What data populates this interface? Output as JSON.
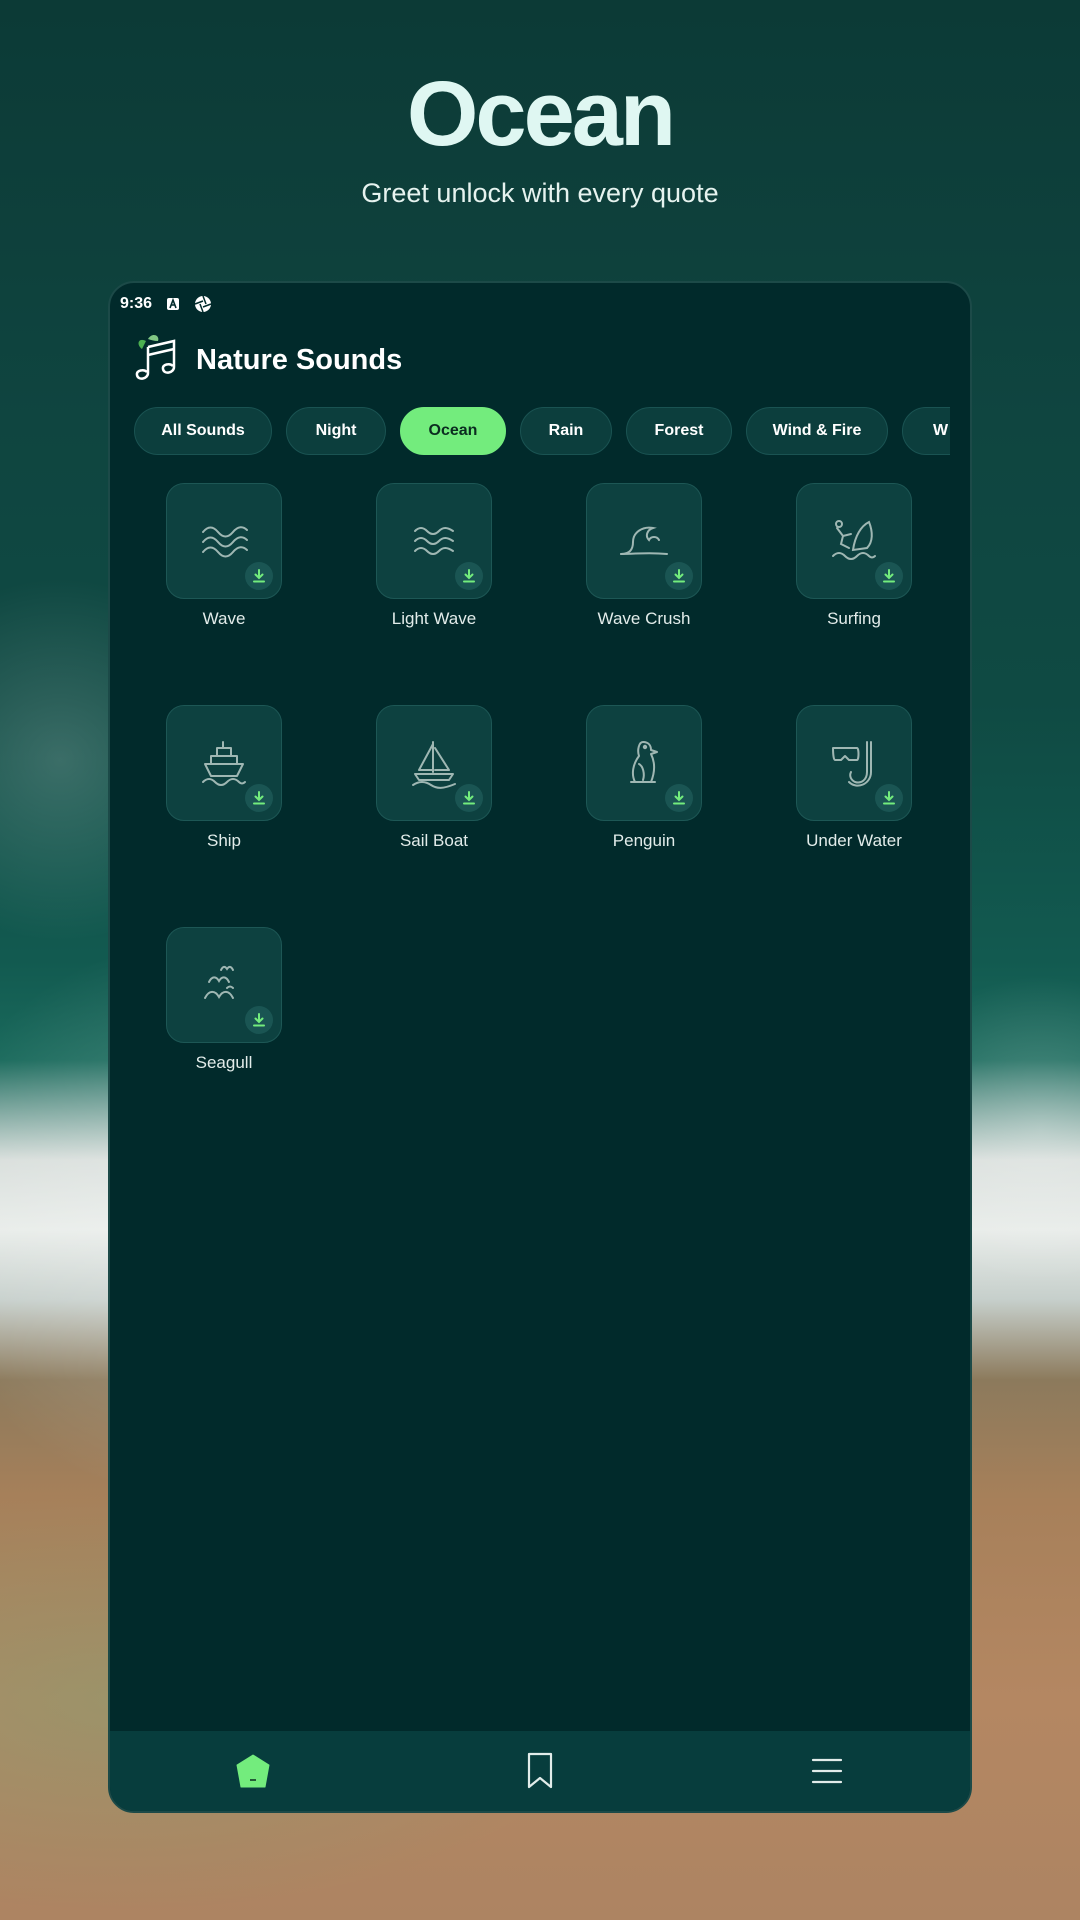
{
  "hero": {
    "title": "Ocean",
    "subtitle": "Greet unlock with every quote"
  },
  "status_bar": {
    "time": "9:36",
    "icons": [
      "a-notification-icon",
      "aperture-icon"
    ]
  },
  "app": {
    "title": "Nature Sounds",
    "logo_icon": "music-leaf-logo-icon"
  },
  "categories": [
    {
      "label": "All Sounds",
      "active": false
    },
    {
      "label": "Night",
      "active": false
    },
    {
      "label": "Ocean",
      "active": true
    },
    {
      "label": "Rain",
      "active": false
    },
    {
      "label": "Forest",
      "active": false
    },
    {
      "label": "Wind & Fire",
      "active": false
    },
    {
      "label": "W",
      "active": false
    }
  ],
  "sounds": [
    {
      "label": "Wave",
      "icon": "wave-icon"
    },
    {
      "label": "Light Wave",
      "icon": "light-wave-icon"
    },
    {
      "label": "Wave Crush",
      "icon": "wave-crush-icon"
    },
    {
      "label": "Surfing",
      "icon": "surfing-icon"
    },
    {
      "label": "Ship",
      "icon": "ship-icon"
    },
    {
      "label": "Sail Boat",
      "icon": "sail-boat-icon"
    },
    {
      "label": "Penguin",
      "icon": "penguin-icon"
    },
    {
      "label": "Under Water",
      "icon": "snorkel-icon"
    },
    {
      "label": "Seagull",
      "icon": "seagull-icon"
    }
  ],
  "bottom_nav": {
    "items": [
      "home-icon",
      "bookmark-icon",
      "menu-icon"
    ],
    "active": "home-icon"
  },
  "colors": {
    "accent": "#73ec7d",
    "surface": "#012a2b",
    "tile": "#0d4140",
    "nav": "#073d3d"
  }
}
